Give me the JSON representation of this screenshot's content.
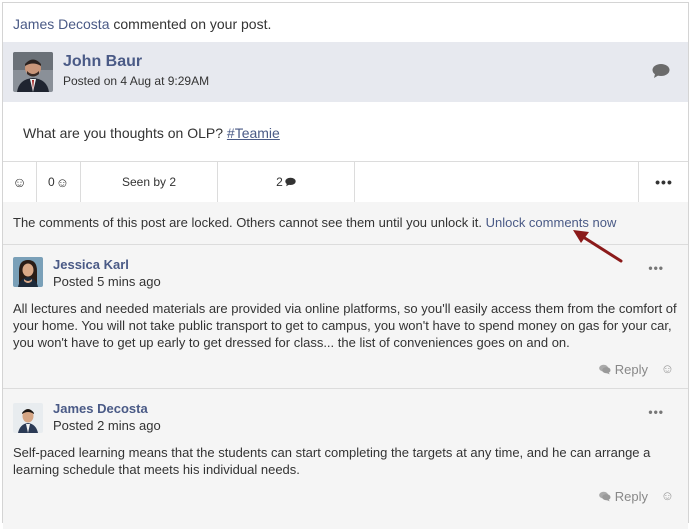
{
  "notification": {
    "actor": "James Decosta",
    "text": " commented on your post."
  },
  "post": {
    "author": "John Baur",
    "posted": "Posted on 4 Aug at 9:29AM",
    "body_text": "What are you thoughts on OLP? ",
    "hashtag": "#Teamie"
  },
  "actions": {
    "smiley": "☺",
    "reactions_count": "0",
    "seen_by": "Seen by 2",
    "comments_count": "2",
    "more": "•••"
  },
  "locked": {
    "text": "The comments of this post are locked. Others cannot see them until you unlock it. ",
    "unlock_link": "Unlock comments now"
  },
  "comments": [
    {
      "author": "Jessica Karl",
      "time": "Posted 5 mins ago",
      "text": "All lectures and needed materials are provided via online platforms, so you'll easily access them from the comfort of your home. You will not take public transport to get to campus, you won't have to spend money on gas for your car, you won't have to get up early to get dressed for class... the list of conveniences goes on and on.",
      "reply_label": "Reply",
      "menu": "•••"
    },
    {
      "author": "James Decosta",
      "time": "Posted 2 mins ago",
      "text": "Self-paced learning means that the students can start completing the targets at any time, and he can arrange a learning schedule that meets his individual needs.",
      "reply_label": "Reply",
      "menu": "•••"
    }
  ],
  "colors": {
    "link": "#4a5a86",
    "header_bg": "#e7e9ef",
    "arrow": "#8b1a1a"
  }
}
